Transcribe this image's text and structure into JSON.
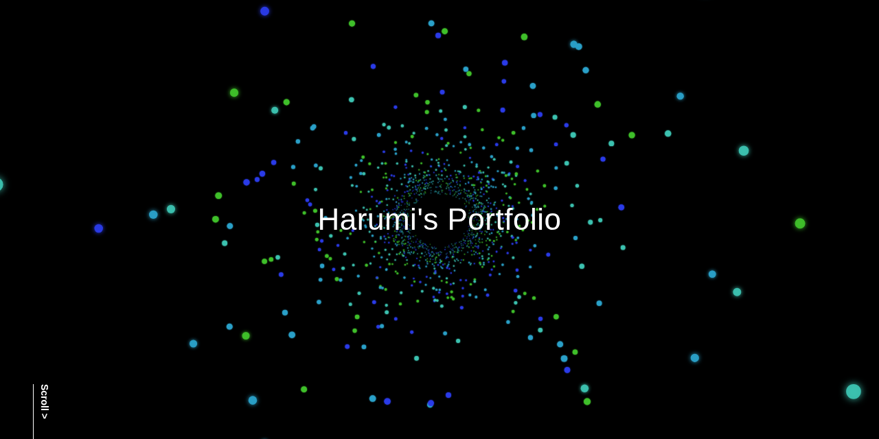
{
  "hero": {
    "title": "Harumi's Portfolio"
  },
  "scroll_hint": {
    "label": "Scroll >"
  }
}
